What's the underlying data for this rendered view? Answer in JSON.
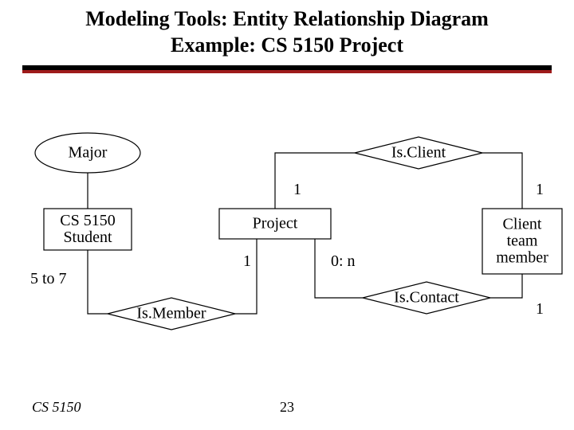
{
  "title_line1": "Modeling Tools: Entity Relationship Diagram",
  "title_line2": "Example:  CS 5150 Project",
  "entities": {
    "major": "Major",
    "student": "CS 5150\nStudent",
    "project": "Project",
    "client_team_member": "Client\nteam\nmember"
  },
  "relationships": {
    "is_client": "Is.Client",
    "is_member": "Is.Member",
    "is_contact": "Is.Contact"
  },
  "cardinalities": {
    "student_major": "",
    "project_isclient_left": "1",
    "isclient_client_right": "1",
    "project_ismember_left": "1",
    "project_iscontact_right": "0: n",
    "ismember_student": "5 to 7",
    "iscontact_client": "1"
  },
  "footer": {
    "course": "CS 5150",
    "page": "23"
  }
}
